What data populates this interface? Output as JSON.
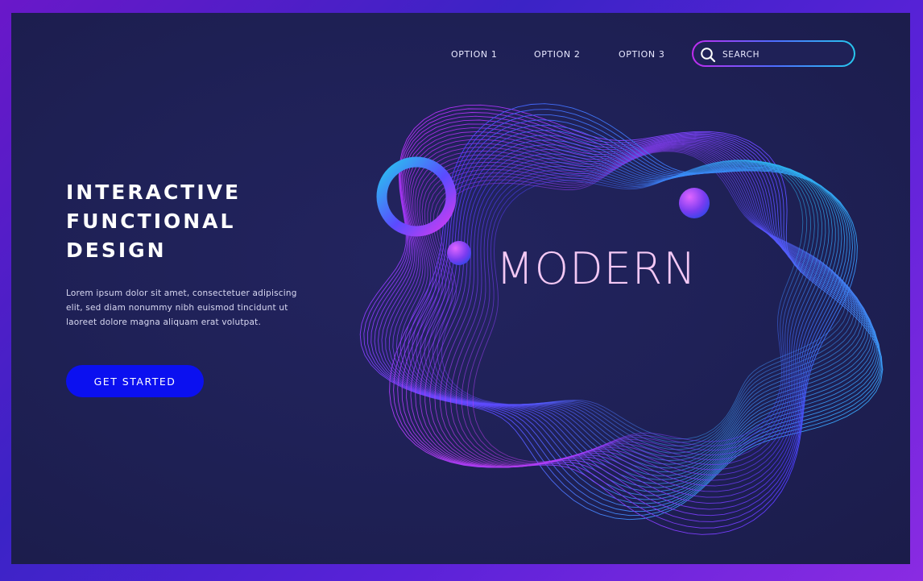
{
  "nav": {
    "items": [
      {
        "label": "OPTION 1"
      },
      {
        "label": "OPTION 2"
      },
      {
        "label": "OPTION 3"
      }
    ]
  },
  "search": {
    "placeholder": "SEARCH",
    "icon": "search-icon"
  },
  "hero": {
    "title_lines": [
      "INTERACTIVE",
      "FUNCTIONAL",
      "DESIGN"
    ],
    "description": "Lorem ipsum dolor sit amet, consectetuer adipiscing elit, sed diam nonummy nibh euismod tincidunt ut laoreet dolore magna aliquam erat volutpat.",
    "cta_label": "GET STARTED"
  },
  "art": {
    "headline": "MODERN"
  },
  "colors": {
    "background": "#1f2157",
    "accent_blue": "#0b10f0",
    "accent_magenta": "#c12cf0",
    "accent_cyan": "#27c7ee",
    "headline": "#f3c8f4"
  }
}
